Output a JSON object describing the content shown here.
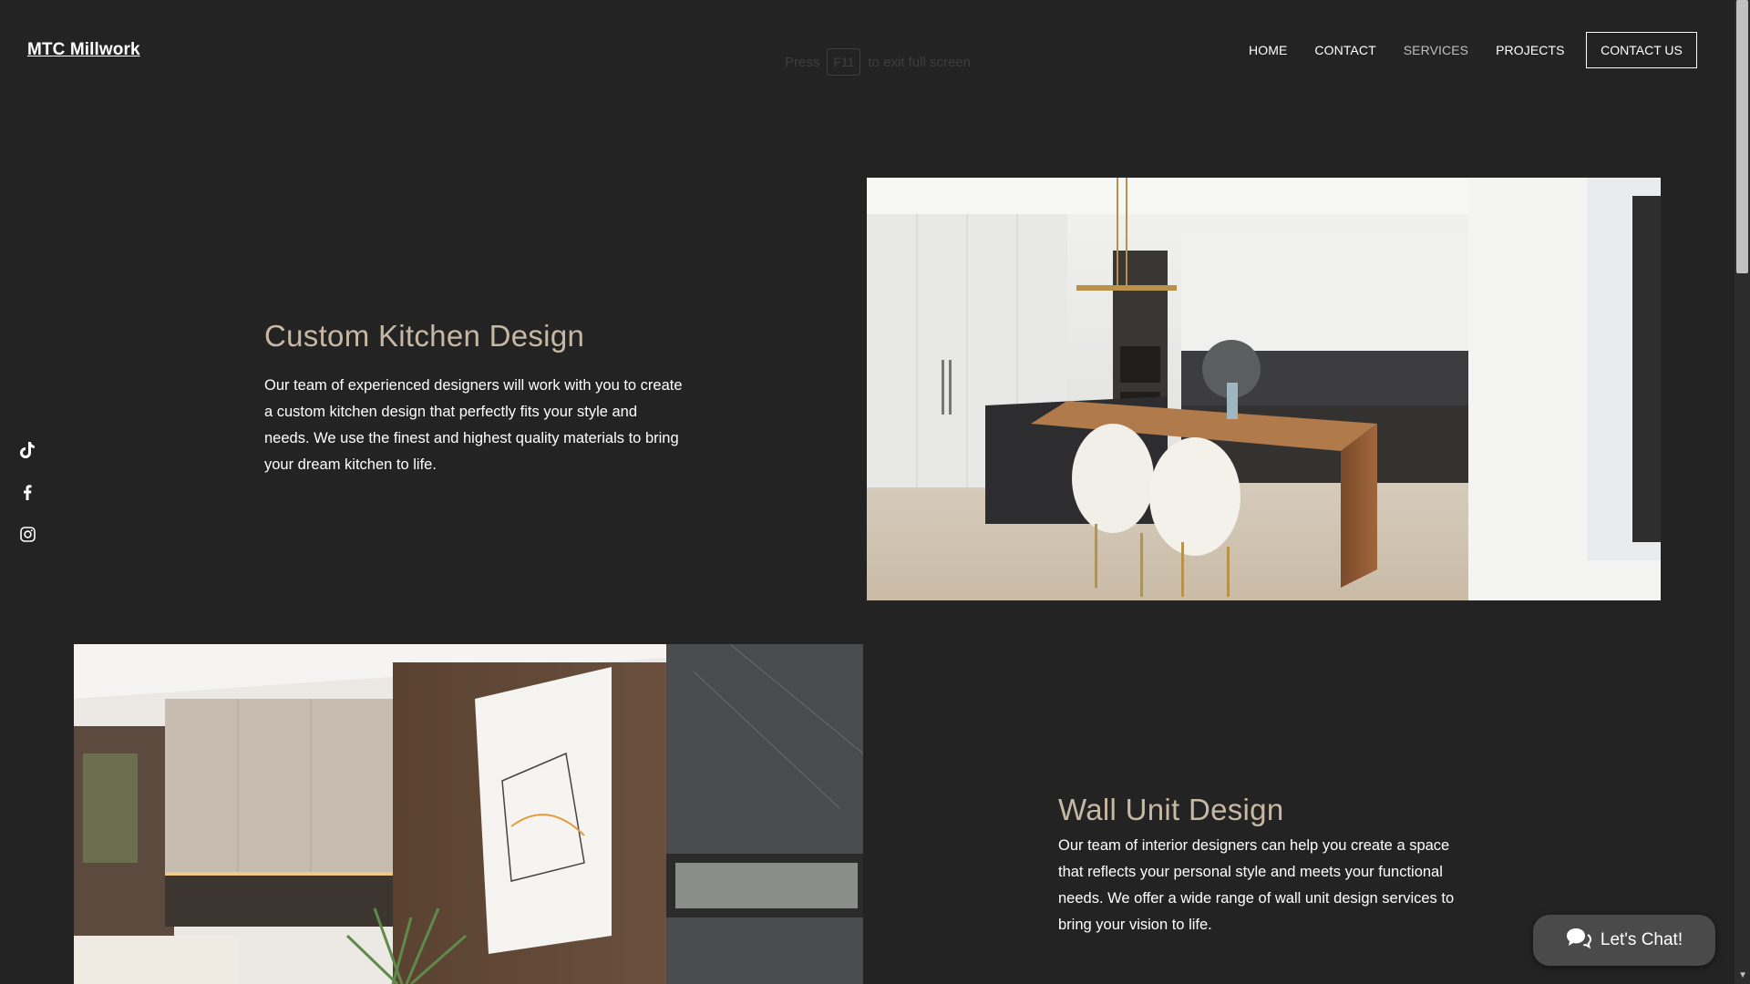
{
  "brand": {
    "logo_text": "MTC Millwork"
  },
  "fullscreen_hint": {
    "press": "Press",
    "key": "F11",
    "rest": "to exit full screen"
  },
  "nav": {
    "items": [
      {
        "label": "HOME"
      },
      {
        "label": "CONTACT"
      },
      {
        "label": "SERVICES"
      },
      {
        "label": "PROJECTS"
      }
    ],
    "cta_label": "CONTACT US"
  },
  "social": {
    "icons": [
      "tiktok-icon",
      "facebook-icon",
      "instagram-icon"
    ]
  },
  "sections": [
    {
      "title": "Custom Kitchen Design",
      "body": "Our team of experienced designers will work with you to create a custom kitchen design that perfectly fits your style and needs. We use the finest and highest quality materials to bring your dream kitchen to life."
    },
    {
      "title": "Wall Unit Design",
      "body": "Our team of interior designers can help you create a space that reflects your personal style and meets your functional needs. We offer a wide range of wall unit design services to bring your vision to life."
    }
  ],
  "chat": {
    "label": "Let's Chat!"
  },
  "colors": {
    "background": "#232323",
    "title_accent": "#c7b8a3",
    "chat_bg": "#4a4a4a"
  }
}
